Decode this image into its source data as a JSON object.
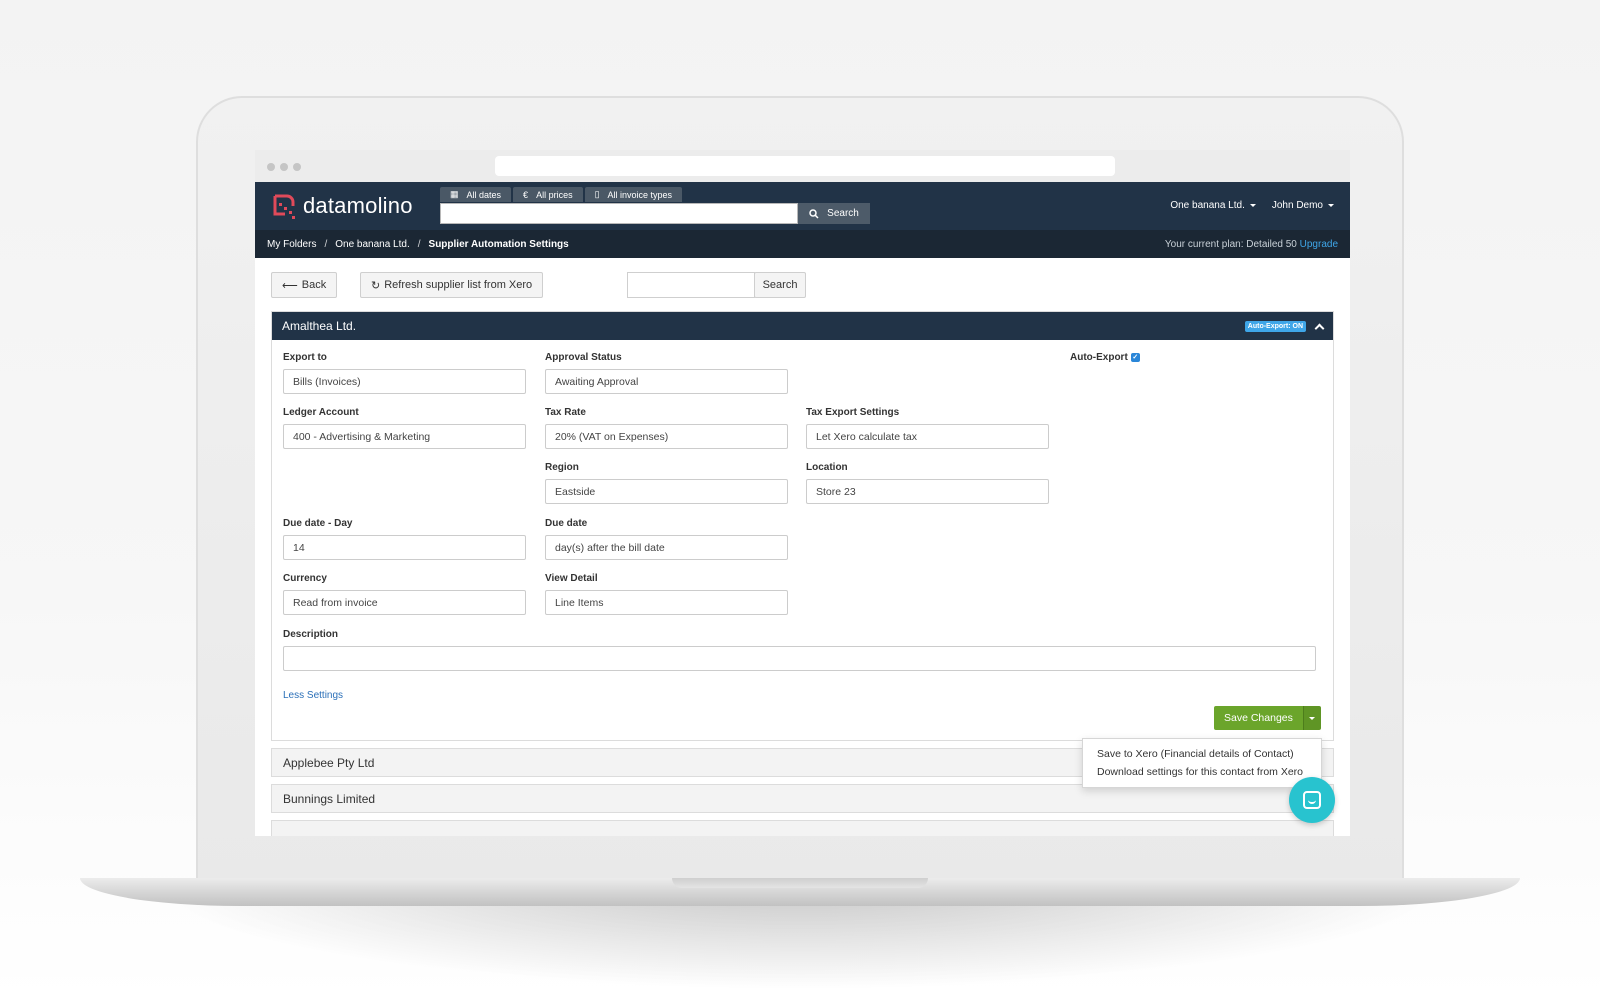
{
  "app": {
    "logo_text": "datamolino"
  },
  "header": {
    "filters": [
      {
        "icon": "calendar-icon",
        "label": "All dates"
      },
      {
        "icon": "euro-icon",
        "label": "All prices"
      },
      {
        "icon": "document-icon",
        "label": "All invoice types"
      }
    ],
    "search_value": "",
    "search_label": "Search",
    "company": "One banana Ltd.",
    "user": "John Demo"
  },
  "breadcrumb": {
    "items": [
      "My Folders",
      "One banana Ltd.",
      "Supplier Automation Settings"
    ],
    "plan_text": "Your current plan: Detailed 50",
    "upgrade": "Upgrade"
  },
  "toolbar": {
    "back_label": "Back",
    "refresh_label": "Refresh supplier list from Xero",
    "search_value": "",
    "search_label": "Search"
  },
  "panel": {
    "title": "Amalthea Ltd.",
    "badge": "Auto-Export: ON",
    "auto_export_label": "Auto-Export",
    "fields": {
      "export_to": {
        "label": "Export to",
        "value": "Bills (Invoices)"
      },
      "approval_status": {
        "label": "Approval Status",
        "value": "Awaiting Approval"
      },
      "ledger_account": {
        "label": "Ledger Account",
        "value": "400 - Advertising & Marketing"
      },
      "tax_rate": {
        "label": "Tax Rate",
        "value": "20% (VAT on Expenses)"
      },
      "tax_export": {
        "label": "Tax Export Settings",
        "value": "Let Xero calculate tax"
      },
      "region": {
        "label": "Region",
        "value": "Eastside"
      },
      "location": {
        "label": "Location",
        "value": "Store 23"
      },
      "due_day": {
        "label": "Due date - Day",
        "value": "14"
      },
      "due_date": {
        "label": "Due date",
        "value": "day(s) after the bill date"
      },
      "currency": {
        "label": "Currency",
        "value": "Read from invoice"
      },
      "view_detail": {
        "label": "View Detail",
        "value": "Line Items"
      },
      "description": {
        "label": "Description",
        "value": ""
      }
    },
    "less_settings": "Less Settings",
    "save_label": "Save Changes",
    "menu": [
      "Save to Xero (Financial details of Contact)",
      "Download settings for this contact from Xero"
    ]
  },
  "suppliers": [
    "Applebee Pty Ltd",
    "Bunnings Limited"
  ],
  "colors": {
    "navy": "#213347",
    "green": "#6ba52b",
    "accent": "#3fa6e8",
    "chat": "#28c3cf"
  }
}
